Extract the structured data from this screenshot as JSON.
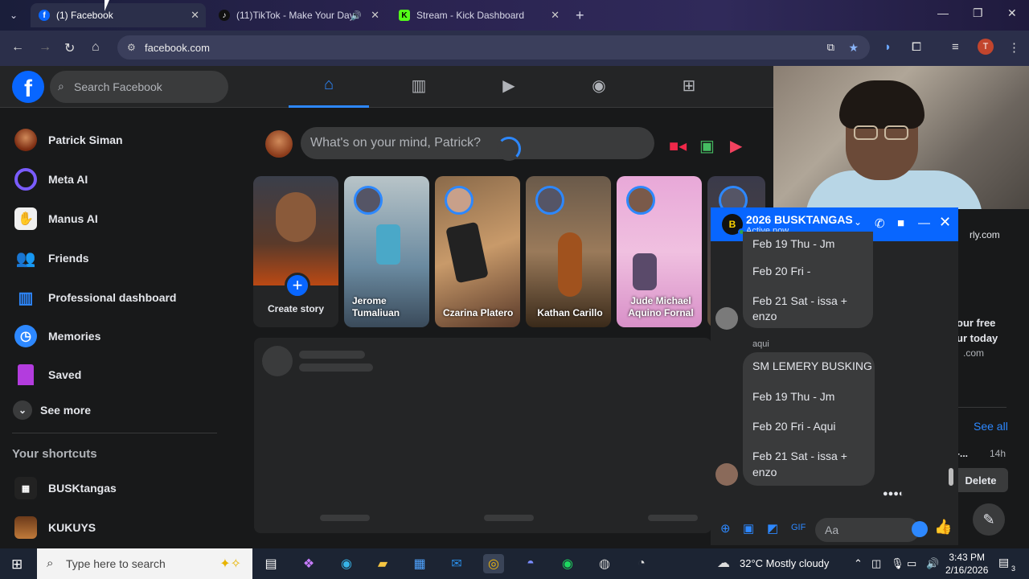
{
  "browser": {
    "tabs": [
      {
        "title": "(1) Facebook",
        "active": true
      },
      {
        "title": "(11)TikTok - Make Your Day",
        "active": false
      },
      {
        "title": "Stream - Kick Dashboard",
        "active": false
      }
    ],
    "url": "facebook.com"
  },
  "fb": {
    "search_placeholder": "Search Facebook",
    "sidebar": [
      {
        "label": "Patrick Siman",
        "icon": "profile-avatar"
      },
      {
        "label": "Meta AI",
        "icon": "meta-ai-icon"
      },
      {
        "label": "Manus AI",
        "icon": "manus-ai-icon"
      },
      {
        "label": "Friends",
        "icon": "friends-icon"
      },
      {
        "label": "Professional dashboard",
        "icon": "dashboard-icon"
      },
      {
        "label": "Memories",
        "icon": "clock-icon"
      },
      {
        "label": "Saved",
        "icon": "bookmark-icon"
      },
      {
        "label": "See more",
        "icon": "chevron-down-icon"
      }
    ],
    "shortcuts_title": "Your shortcuts",
    "shortcuts": [
      {
        "label": "BUSKtangas"
      },
      {
        "label": "KUKUYS"
      }
    ],
    "composer_placeholder": "What's on your mind, Patrick?",
    "stories": [
      {
        "name": "Create story"
      },
      {
        "name": "Jerome Tumaliuan"
      },
      {
        "name": "Czarina Platero"
      },
      {
        "name": "Kathan Carillo"
      },
      {
        "name": "Jude Michael Aquino Fornal"
      }
    ]
  },
  "chat": {
    "name": "2026 BUSKTANGAS",
    "status": "Active now",
    "messages_top": [
      "Feb 19 Thu - Jm",
      "Feb 20 Fri -",
      "Feb 21 Sat - issa +",
      "enzo"
    ],
    "sender_label": "aqui",
    "messages_bottom": [
      "SM LEMERY BUSKING",
      "Feb 19 Thu - Jm",
      "Feb 20 Fri - Aqui",
      "Feb 21 Sat - issa +",
      "enzo"
    ],
    "input_placeholder": "Aa"
  },
  "right_panel": {
    "text1": "rly.com",
    "text2": "our free",
    "text3": "ur today",
    "text4": ".com",
    "see_all": "See all",
    "time": "14h",
    "dash": "-...",
    "delete": "Delete"
  },
  "taskbar": {
    "search_placeholder": "Type here to search",
    "weather": "32°C  Mostly cloudy",
    "time": "3:43 PM",
    "date": "2/16/2026",
    "notif_count": "3"
  },
  "colors": {
    "fb_blue": "#0866ff",
    "bg": "#18191a",
    "card": "#242526"
  }
}
